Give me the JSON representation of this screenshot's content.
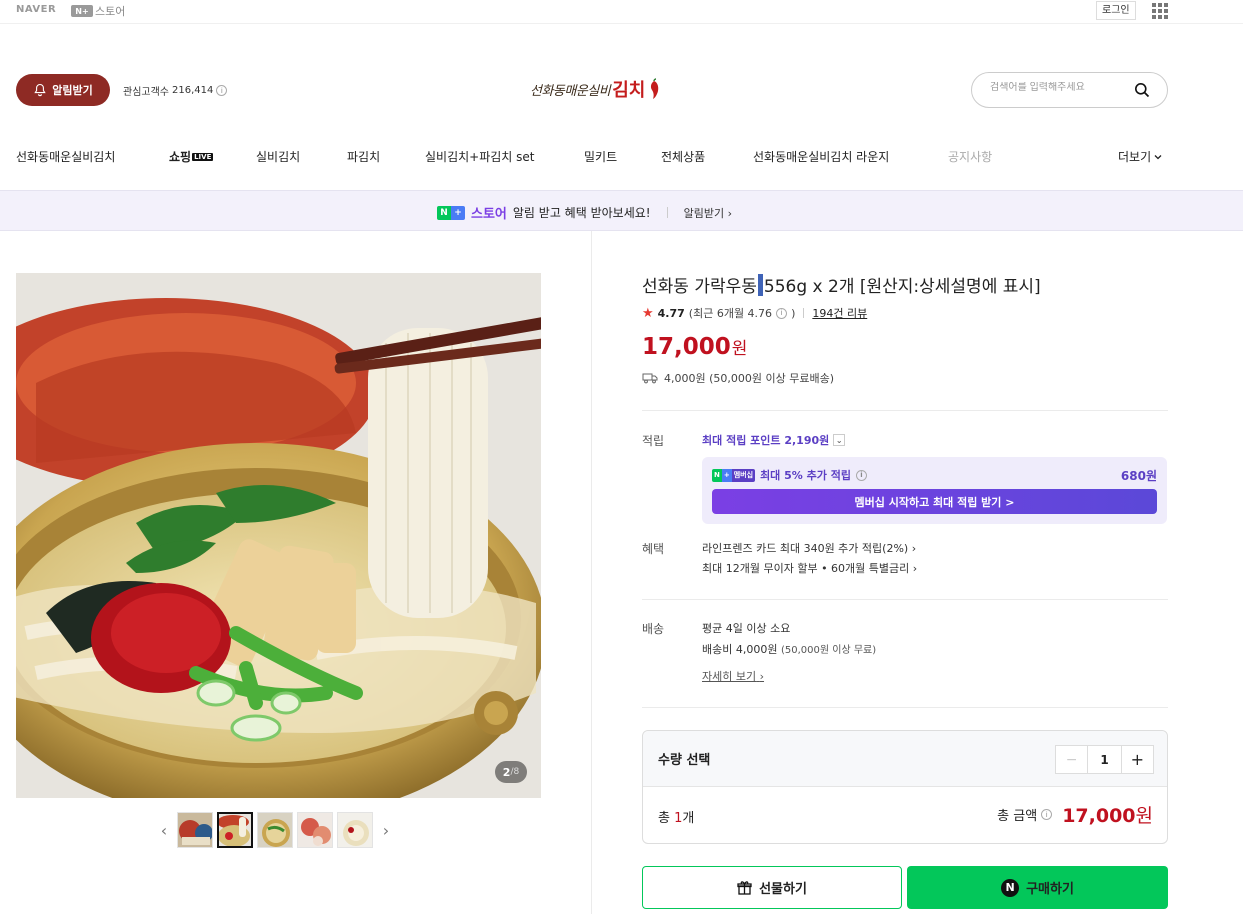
{
  "topbar": {
    "naver": "NAVER",
    "np_badge": "N+",
    "np_store": "스토어",
    "login": "로그인"
  },
  "header": {
    "alarm_button": "알림받기",
    "interest_label": "관심고객수",
    "interest_count": "216,414",
    "brand_text": "선화동매운실비",
    "brand_kimchi": "김치",
    "search_placeholder": "검색어를 입력해주세요"
  },
  "nav": {
    "items": [
      "선화동매운실비김치",
      "쇼핑",
      "실비김치",
      "파김치",
      "실비김치+파김치 set",
      "밀키트",
      "전체상품",
      "선화동매운실비김치 라운지",
      "공지사항"
    ],
    "live_tag": "LIVE",
    "more": "더보기"
  },
  "banner": {
    "store": "스토어",
    "message": "알림 받고 혜택 받아보세요!",
    "link": "알림받기"
  },
  "gallery": {
    "current": "2",
    "total": "8"
  },
  "product": {
    "title_pre": "선화동 가락우동",
    "title_post": "556g x 2개 [원산지:상세설명에 표시]",
    "rating": "4.77",
    "rating_recent": "(최근 6개월 4.76",
    "rating_recent_close": ")",
    "reviews": "194건 리뷰",
    "price": "17,000",
    "currency": "원",
    "shipping_fee": "4,000원 (50,000원 이상 무료배송)"
  },
  "points": {
    "label": "적립",
    "max_points": "최대 적립 포인트 2,190원",
    "member_badge": "멤버십",
    "member_extra": "최대 5% 추가 적립",
    "member_amount": "680원",
    "member_cta": "멤버십 시작하고 최대 적립 받기 >"
  },
  "benefits": {
    "label": "혜택",
    "line1": "라인프렌즈 카드 최대 340원 추가 적립(2%)",
    "line2": "최대 12개월 무이자 할부 • 60개월 특별금리"
  },
  "shipping": {
    "label": "배송",
    "line1": "평균 4일 이상 소요",
    "line2_main": "배송비 4,000원",
    "line2_note": "(50,000원 이상 무료)",
    "details": "자세히 보기"
  },
  "quantity": {
    "title": "수량 선택",
    "value": "1",
    "total_prefix": "총 ",
    "total_count": "1",
    "total_suffix": "개",
    "total_label": "총 금액",
    "total_amount": "17,000",
    "total_currency": "원"
  },
  "actions": {
    "gift": "선물하기",
    "buy": "구매하기"
  },
  "colors": {
    "brand_red": "#8e2a24",
    "price_red": "#c0111f",
    "naver_green": "#03c75a",
    "membership_purple": "#5b3fc4"
  }
}
